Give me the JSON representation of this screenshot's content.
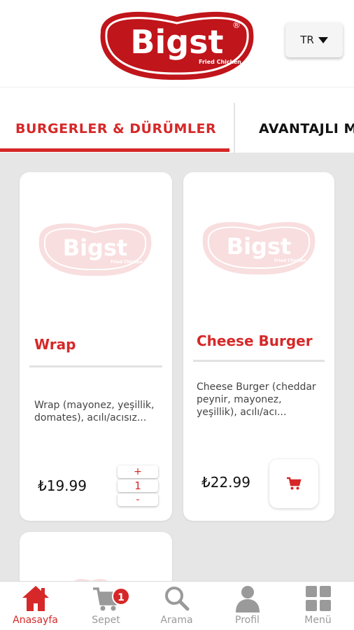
{
  "brand": {
    "logo_text": "Bigst",
    "logo_subtext": "Fried Chicken",
    "logo_mark": "®",
    "primary_color": "#d62828"
  },
  "header": {
    "language": "TR"
  },
  "tabs": [
    {
      "label": "BURGERLER & DÜRÜMLER",
      "active": true
    },
    {
      "label": "AVANTAJLI M",
      "active": false
    }
  ],
  "products": [
    {
      "name": "Wrap",
      "description": "Wrap (mayonez, yeşillik, domates), acılı/acısız...",
      "price": "₺19.99",
      "quantity": "1",
      "plus_label": "+",
      "minus_label": "-"
    },
    {
      "name": "Cheese Burger",
      "description": "Cheese Burger (cheddar peynir, mayonez, yeşillik), acılı/acı...",
      "price": "₺22.99",
      "cart_icon": "cart-icon"
    }
  ],
  "bottom_nav": [
    {
      "label": "Anasayfa",
      "icon": "home-icon",
      "active": true
    },
    {
      "label": "Sepet",
      "icon": "cart-icon",
      "badge": "1"
    },
    {
      "label": "Arama",
      "icon": "search-icon"
    },
    {
      "label": "Profil",
      "icon": "user-icon"
    },
    {
      "label": "Menü",
      "icon": "grid-icon"
    }
  ]
}
